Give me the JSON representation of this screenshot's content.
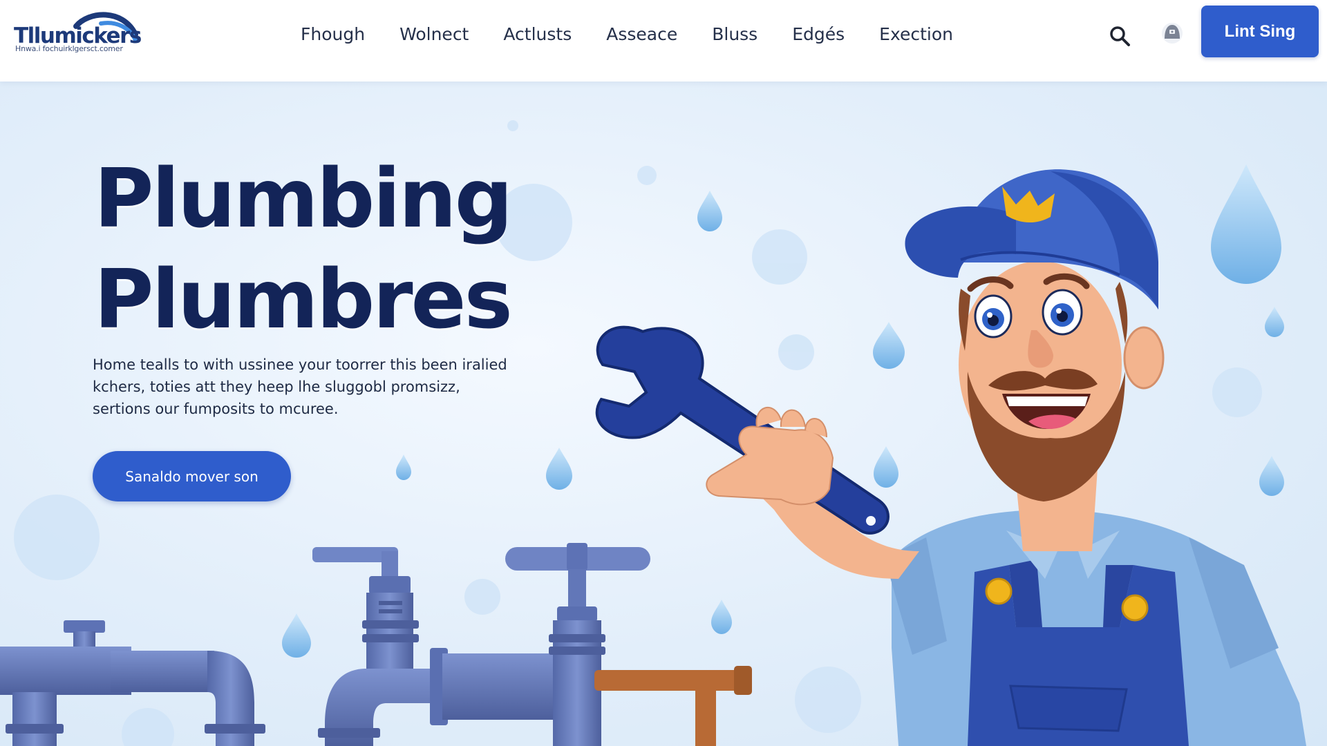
{
  "brand": {
    "name": "Tllumickers",
    "tagline": "Hnwa.i fochuirklgersct.comer"
  },
  "nav": {
    "items": [
      {
        "label": "Fhough"
      },
      {
        "label": "Wolnect"
      },
      {
        "label": "Actlusts"
      },
      {
        "label": "Asseace"
      },
      {
        "label": "Bluss"
      },
      {
        "label": "Edgés"
      },
      {
        "label": "Exection"
      }
    ]
  },
  "header": {
    "search_icon": "search-icon",
    "account_icon": "account-icon",
    "cta_label": "Lint Sing"
  },
  "hero": {
    "title_line1": "Plumbing",
    "title_line2": "Plumbres",
    "description": "Home tealls to with ussinee your toorrer this been iralied kchers, toties att they heep lhe sluggobl promsizz, sertions our fumposits to mcuree.",
    "cta_label": "Sanaldo mover son"
  },
  "colors": {
    "primary": "#2f5dcc",
    "title": "#132458",
    "background": "#e2eefa",
    "pipe": "#6078b8",
    "droplet": "#8ec3ee"
  }
}
